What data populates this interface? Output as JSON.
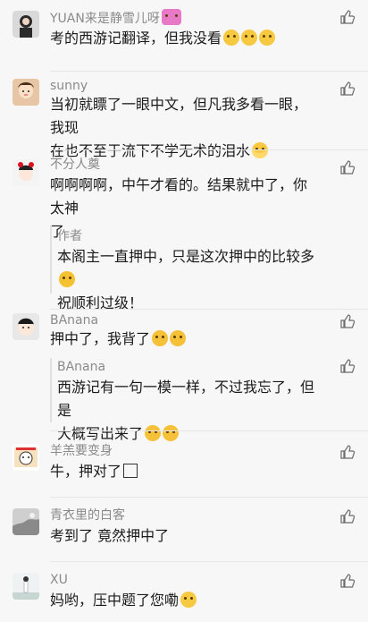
{
  "comments": [
    {
      "author": "YUAN来是静雪儿呀",
      "text": "考的西游记翻译，但我没看",
      "author_emoji": "heart-icon",
      "emojis": [
        "laugh-cry-emoji",
        "laugh-cry-emoji",
        "laugh-cry-emoji"
      ]
    },
    {
      "author": "sunny",
      "text_lines": [
        "当初就瞟了一眼中文，但凡我多看一眼，我现",
        "在也不至于流下不学无术的泪水"
      ],
      "emojis": [
        "crying-emoji"
      ]
    },
    {
      "author": "不分人奠",
      "text_lines": [
        "啊啊啊啊，中午才看的。结果就中了，你太神",
        "了"
      ],
      "reply": {
        "author": "作者",
        "text_lines": [
          "本阁主一直押中，只是这次押中的比较多",
          "祝顺利过级！"
        ],
        "emojis": [
          "smile-emoji"
        ]
      }
    },
    {
      "author": "BAnana",
      "text": "押中了，我背了",
      "emojis": [
        "tongue-emoji",
        "tongue-emoji"
      ],
      "reply": {
        "author": "BAnana",
        "text_lines": [
          "西游记有一句一模一样，不过我忘了，但是",
          "大概写出来了"
        ],
        "emojis": [
          "grin-emoji",
          "grin-emoji"
        ]
      }
    },
    {
      "author": "羊羔要变身",
      "text": "牛，押对了"
    },
    {
      "author": "青衣里的白客",
      "text": "考到了 竟然押中了"
    },
    {
      "author": "XU",
      "text": "妈哟，压中题了您嘞",
      "emojis": [
        "laugh-cry-emoji"
      ]
    }
  ]
}
